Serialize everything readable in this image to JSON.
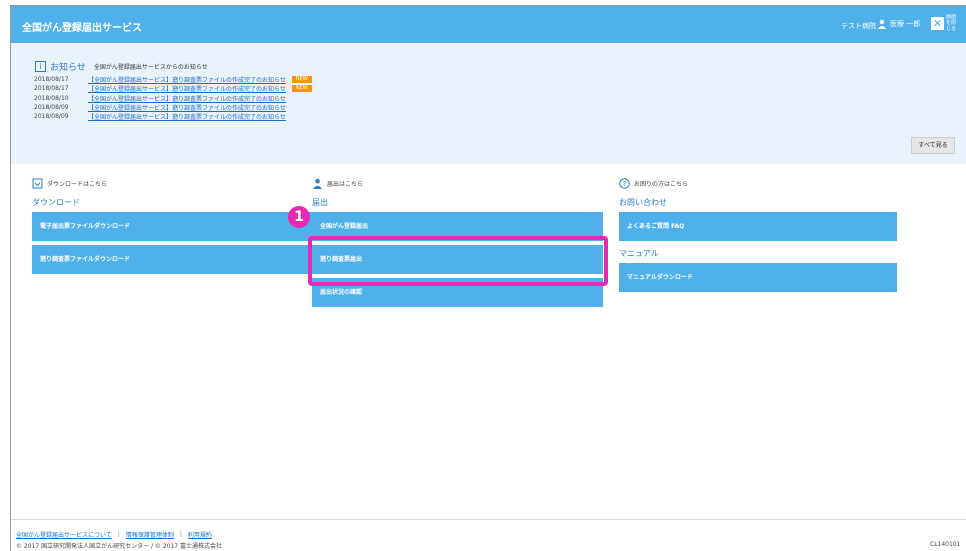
{
  "header": {
    "title": "全国がん登録届出サービス",
    "env": "テスト病院",
    "user": "医療 一郎",
    "close_icon": "close-icon",
    "close_label": "画面を閉じる"
  },
  "notice": {
    "title": "お知らせ",
    "subtitle": "全国がん登録届出サービスからのお知らせ",
    "items": [
      {
        "date": "2018/08/17",
        "text": "【全国がん登録届出サービス】遡り調査票ファイルの作成完了のお知らせ",
        "badge": "NEW"
      },
      {
        "date": "2018/08/17",
        "text": "【全国がん登録届出サービス】遡り調査票ファイルの作成完了のお知らせ",
        "badge": "NEW"
      },
      {
        "date": "2018/08/10",
        "text": "【全国がん登録届出サービス】遡り調査票ファイルの作成完了のお知らせ",
        "badge": ""
      },
      {
        "date": "2018/08/09",
        "text": "【全国がん登録届出サービス】遡り調査票ファイルの作成完了のお知らせ",
        "badge": ""
      },
      {
        "date": "2018/08/09",
        "text": "【全国がん登録届出サービス】遡り調査票ファイルの作成完了のお知らせ",
        "badge": ""
      }
    ],
    "view_all": "すべて見る"
  },
  "download": {
    "head": "ダウンロードはこちら",
    "section": "ダウンロード",
    "buttons": [
      "電子届出票ファイルダウンロード",
      "遡り調査票ファイルダウンロード"
    ]
  },
  "submit": {
    "head": "届出はこちら",
    "section": "届出",
    "buttons": [
      "全国がん登録届出",
      "遡り調査票届出",
      "届出状況の確認"
    ]
  },
  "contact": {
    "head": "お困りの方はこちら",
    "section": "お問い合わせ",
    "buttons": [
      "よくあるご質問 FAQ"
    ],
    "manual_section": "マニュアル",
    "manual_buttons": [
      "マニュアルダウンロード"
    ]
  },
  "annotation": {
    "step": "1",
    "color": "#e529b5"
  },
  "footer": {
    "links": [
      "全国がん登録届出サービスについて",
      "情報保護管理体制",
      "利用規約"
    ],
    "copyright": "© 2017 国立研究開発法人国立がん研究センター / © 2017 富士通株式会社",
    "screen_code": "CL140101"
  },
  "colors": {
    "header": "#4fb0ea",
    "accent": "#2a7fc9",
    "new_badge": "#f39800"
  }
}
